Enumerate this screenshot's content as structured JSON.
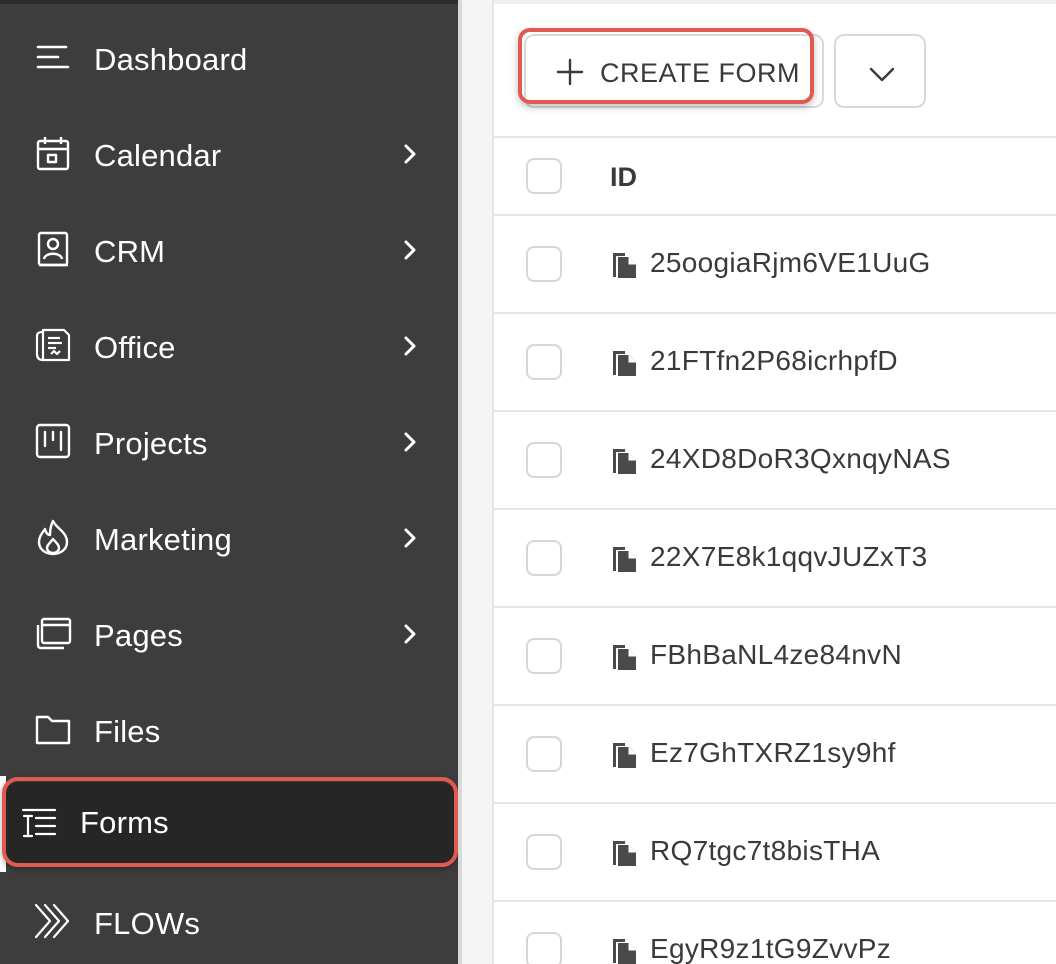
{
  "sidebar": {
    "items": [
      {
        "label": "Dashboard",
        "icon": "menu-lines-icon",
        "has_submenu": false
      },
      {
        "label": "Calendar",
        "icon": "calendar-icon",
        "has_submenu": true
      },
      {
        "label": "CRM",
        "icon": "contact-book-icon",
        "has_submenu": true
      },
      {
        "label": "Office",
        "icon": "receipt-icon",
        "has_submenu": true
      },
      {
        "label": "Projects",
        "icon": "kanban-icon",
        "has_submenu": true
      },
      {
        "label": "Marketing",
        "icon": "flame-icon",
        "has_submenu": true
      },
      {
        "label": "Pages",
        "icon": "browser-pages-icon",
        "has_submenu": true
      },
      {
        "label": "Files",
        "icon": "folder-icon",
        "has_submenu": false
      },
      {
        "label": "Forms",
        "icon": "form-list-icon",
        "has_submenu": false,
        "active": true
      },
      {
        "label": "FLOWs",
        "icon": "chevrons-right-icon",
        "has_submenu": false
      }
    ]
  },
  "toolbar": {
    "create_label": "CREATE FORM",
    "create_icon": "plus-icon",
    "dropdown_icon": "chevron-down-icon"
  },
  "table": {
    "header": {
      "id_label": "ID"
    },
    "rows": [
      {
        "id": "25oogiaRjm6VE1UuG"
      },
      {
        "id": "21FTfn2P68icrhpfD"
      },
      {
        "id": "24XD8DoR3QxnqyNAS"
      },
      {
        "id": "22X7E8k1qqvJUZxT3"
      },
      {
        "id": "FBhBaNL4ze84nvN"
      },
      {
        "id": "Ez7GhTXRZ1sy9hf"
      },
      {
        "id": "RQ7tgc7t8bisTHA"
      },
      {
        "id": "EgyR9z1tG9ZvvPz"
      }
    ]
  },
  "colors": {
    "sidebar_bg": "#3d3d3d",
    "active_item_bg": "#262626",
    "highlight": "#e05a4f",
    "text_dark": "#3a3a3a"
  }
}
